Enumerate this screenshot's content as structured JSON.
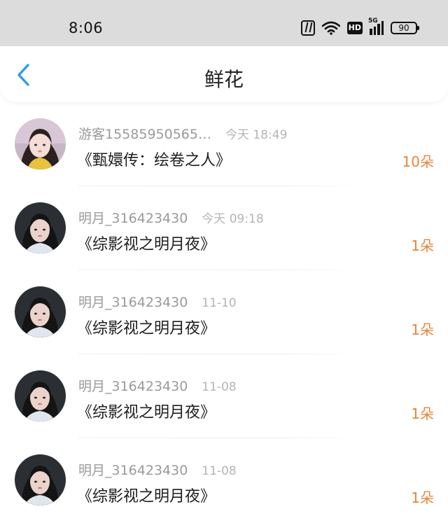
{
  "status_bar": {
    "time": "8:06",
    "network_type": "5G",
    "hd_badge": "HD",
    "battery": "90",
    "icons": [
      "nfc-icon",
      "wifi-icon",
      "hd-icon",
      "signal-5g-icon",
      "battery-icon"
    ]
  },
  "nav": {
    "title": "鲜花",
    "back_icon": "chevron-left-icon",
    "accent_color": "#2a9de3"
  },
  "records": [
    {
      "user": "游客15585950565…",
      "time": "今天 18:49",
      "book": "《甄嬛传：绘卷之人》",
      "count": "10朵",
      "avatar": "avatar-girl-yellow"
    },
    {
      "user": "明月_316423430",
      "time": "今天 09:18",
      "book": "《综影视之明月夜》",
      "count": "1朵",
      "avatar": "avatar-girl-dark"
    },
    {
      "user": "明月_316423430",
      "time": "11-10",
      "book": "《综影视之明月夜》",
      "count": "1朵",
      "avatar": "avatar-girl-dark"
    },
    {
      "user": "明月_316423430",
      "time": "11-08",
      "book": "《综影视之明月夜》",
      "count": "1朵",
      "avatar": "avatar-girl-dark"
    },
    {
      "user": "明月_316423430",
      "time": "11-08",
      "book": "《综影视之明月夜》",
      "count": "1朵",
      "avatar": "avatar-girl-dark"
    }
  ],
  "colors": {
    "count": "#e8843a",
    "name": "#9a9a9a",
    "time": "#b4b4b4",
    "status_bar_bg": "#dcdcdc"
  }
}
